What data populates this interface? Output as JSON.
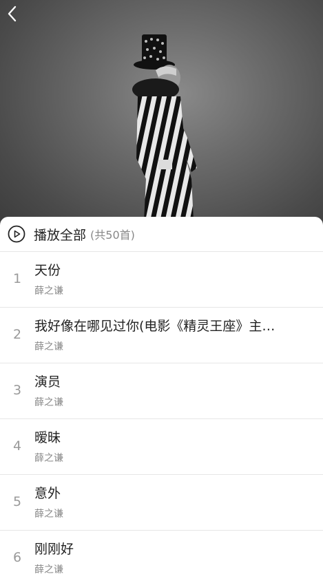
{
  "header": {
    "back_icon": "chevron-left-icon"
  },
  "play_all": {
    "icon": "play-circle-icon",
    "label": "播放全部",
    "count": "(共50首)"
  },
  "songs": [
    {
      "index": "1",
      "title": "天份",
      "artist": "薛之谦"
    },
    {
      "index": "2",
      "title": "我好像在哪见过你(电影《精灵王座》主…",
      "artist": "薛之谦"
    },
    {
      "index": "3",
      "title": "演员",
      "artist": "薛之谦"
    },
    {
      "index": "4",
      "title": "暧昧",
      "artist": "薛之谦"
    },
    {
      "index": "5",
      "title": "意外",
      "artist": "薛之谦"
    },
    {
      "index": "6",
      "title": "刚刚好",
      "artist": "薛之谦"
    }
  ]
}
